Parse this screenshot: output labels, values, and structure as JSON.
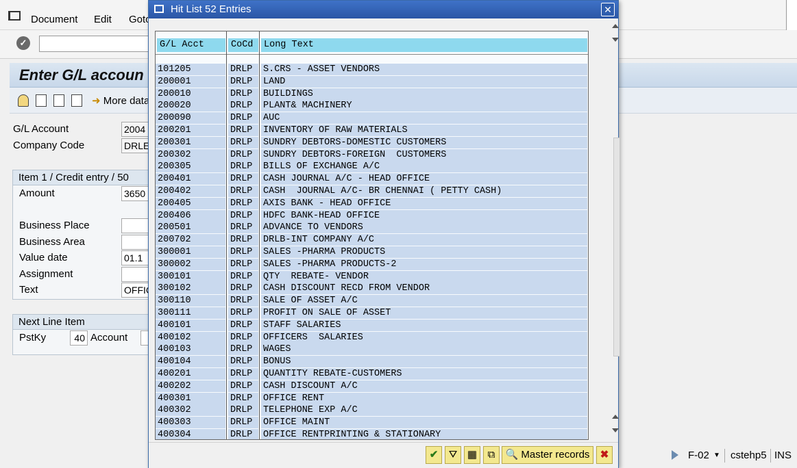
{
  "menubar": {
    "items": [
      "Document",
      "Edit",
      "Goto"
    ]
  },
  "screen": {
    "title": "Enter G/L accoun",
    "more_data": "More data",
    "gl_account_label": "G/L Account",
    "gl_account_value": "2004",
    "company_code_label": "Company Code",
    "company_code_value": "DRLE",
    "item_group_title": "Item 1 / Credit entry / 50",
    "amount_label": "Amount",
    "amount_value": "3650",
    "business_place_label": "Business Place",
    "business_area_label": "Business Area",
    "value_date_label": "Value date",
    "value_date_value": "01.1",
    "assignment_label": "Assignment",
    "text_label": "Text",
    "text_value": "OFFIC",
    "next_line_title": "Next Line Item",
    "pstky_label": "PstKy",
    "pstky_value": "40",
    "account_label": "Account"
  },
  "statusbar": {
    "transaction": "F-02",
    "server": "cstehp5",
    "mode": "INS"
  },
  "dialog": {
    "title": "Hit List 52 Entries",
    "columns": [
      "G/L Acct",
      "CoCd",
      "Long Text"
    ],
    "rows": [
      {
        "acct": "101205",
        "cocd": "DRLP",
        "text": "S.CRS - ASSET VENDORS"
      },
      {
        "acct": "200001",
        "cocd": "DRLP",
        "text": "LAND"
      },
      {
        "acct": "200010",
        "cocd": "DRLP",
        "text": "BUILDINGS"
      },
      {
        "acct": "200020",
        "cocd": "DRLP",
        "text": "PLANT& MACHINERY"
      },
      {
        "acct": "200090",
        "cocd": "DRLP",
        "text": "AUC"
      },
      {
        "acct": "200201",
        "cocd": "DRLP",
        "text": "INVENTORY OF RAW MATERIALS"
      },
      {
        "acct": "200301",
        "cocd": "DRLP",
        "text": "SUNDRY DEBTORS-DOMESTIC CUSTOMERS"
      },
      {
        "acct": "200302",
        "cocd": "DRLP",
        "text": "SUNDRY DEBTORS-FOREIGN  CUSTOMERS"
      },
      {
        "acct": "200305",
        "cocd": "DRLP",
        "text": "BILLS OF EXCHANGE A/C"
      },
      {
        "acct": "200401",
        "cocd": "DRLP",
        "text": "CASH JOURNAL A/C - HEAD OFFICE"
      },
      {
        "acct": "200402",
        "cocd": "DRLP",
        "text": "CASH  JOURNAL A/C- BR CHENNAI ( PETTY CASH)"
      },
      {
        "acct": "200405",
        "cocd": "DRLP",
        "text": "AXIS BANK - HEAD OFFICE"
      },
      {
        "acct": "200406",
        "cocd": "DRLP",
        "text": "HDFC BANK-HEAD OFFICE"
      },
      {
        "acct": "200501",
        "cocd": "DRLP",
        "text": "ADVANCE TO VENDORS"
      },
      {
        "acct": "200702",
        "cocd": "DRLP",
        "text": "DRLB-INT COMPANY A/C"
      },
      {
        "acct": "300001",
        "cocd": "DRLP",
        "text": "SALES -PHARMA PRODUCTS"
      },
      {
        "acct": "300002",
        "cocd": "DRLP",
        "text": "SALES -PHARMA PRODUCTS-2"
      },
      {
        "acct": "300101",
        "cocd": "DRLP",
        "text": "QTY  REBATE- VENDOR"
      },
      {
        "acct": "300102",
        "cocd": "DRLP",
        "text": "CASH DISCOUNT RECD FROM VENDOR"
      },
      {
        "acct": "300110",
        "cocd": "DRLP",
        "text": "SALE OF ASSET A/C"
      },
      {
        "acct": "300111",
        "cocd": "DRLP",
        "text": "PROFIT ON SALE OF ASSET"
      },
      {
        "acct": "400101",
        "cocd": "DRLP",
        "text": "STAFF SALARIES"
      },
      {
        "acct": "400102",
        "cocd": "DRLP",
        "text": "OFFICERS  SALARIES"
      },
      {
        "acct": "400103",
        "cocd": "DRLP",
        "text": "WAGES"
      },
      {
        "acct": "400104",
        "cocd": "DRLP",
        "text": "BONUS"
      },
      {
        "acct": "400201",
        "cocd": "DRLP",
        "text": "QUANTITY REBATE-CUSTOMERS"
      },
      {
        "acct": "400202",
        "cocd": "DRLP",
        "text": "CASH DISCOUNT A/C"
      },
      {
        "acct": "400301",
        "cocd": "DRLP",
        "text": "OFFICE RENT"
      },
      {
        "acct": "400302",
        "cocd": "DRLP",
        "text": "TELEPHONE EXP A/C"
      },
      {
        "acct": "400303",
        "cocd": "DRLP",
        "text": "OFFICE MAINT"
      },
      {
        "acct": "400304",
        "cocd": "DRLP",
        "text": "OFFICE RENTPRINTING & STATIONARY"
      }
    ],
    "footer": {
      "master_records_label": "Master records"
    }
  },
  "colors": {
    "header_cell": "#8ed9ee",
    "row_cell": "#c9d9ee",
    "title_bar": "#2a56a5",
    "footer_button": "#f3e88f"
  }
}
